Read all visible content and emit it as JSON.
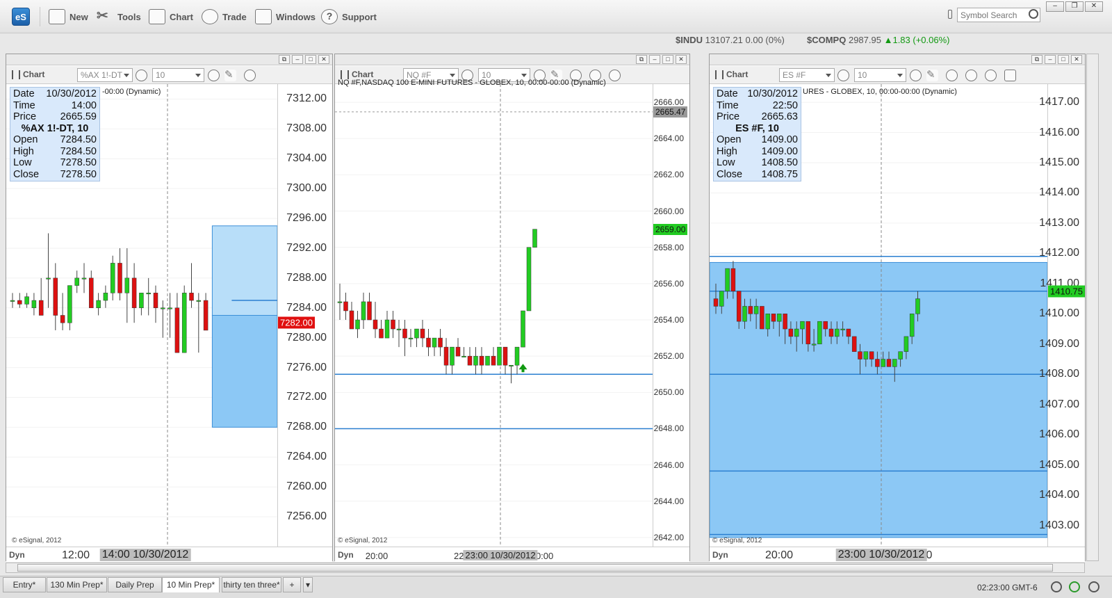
{
  "app": {
    "logo": "eS"
  },
  "toolbar": {
    "items": [
      {
        "label": "New",
        "icon": "new-window-icon"
      },
      {
        "label": "Tools",
        "icon": "tools-icon"
      },
      {
        "label": "Chart",
        "icon": "chart-icon"
      },
      {
        "label": "Trade",
        "icon": "trade-globe-icon"
      },
      {
        "label": "Windows",
        "icon": "windows-icon"
      },
      {
        "label": "Support",
        "icon": "help-icon"
      }
    ],
    "search_placeholder": "Symbol Search"
  },
  "tickers": [
    {
      "sym": "$INDU",
      "price": "13107.21",
      "chg": "0.00 (0%)",
      "dir": "flat"
    },
    {
      "sym": "$COMPQ",
      "price": "2987.95",
      "chg": "1.83 (+0.06%)",
      "dir": "up"
    }
  ],
  "panels": [
    {
      "chart_label": "Chart",
      "symbol": "%AX 1!-DT",
      "interval": "10",
      "header": "-00:00 (Dynamic)",
      "info": {
        "date": "10/30/2012",
        "time": "14:00",
        "price": "2665.59",
        "title": "%AX 1!-DT, 10",
        "open": "7284.50",
        "high": "7284.50",
        "low": "7278.50",
        "close": "7278.50"
      },
      "price_tag": "7282.00",
      "price_tag_color": "#e01010",
      "copyright": "© eSignal, 2012",
      "dyn": "Dyn",
      "x_labels": [
        "12:00"
      ],
      "x_cursor": "14:00 10/30/2012"
    },
    {
      "chart_label": "Chart",
      "symbol": "NQ #F",
      "interval": "10",
      "header": "NQ #F,NASDAQ 100 E-MINI FUTURES - GLOBEX, 10, 00:00-00:00 (Dynamic)",
      "price_tag": "2659.00",
      "price_tag_color": "#22cc22",
      "cursor_tag": "2665.47",
      "copyright": "© eSignal, 2012",
      "dyn": "Dyn",
      "x_labels": [
        "20:00",
        "22:",
        "00:00"
      ],
      "x_cursor": "23:00 10/30/2012"
    },
    {
      "chart_label": "Chart",
      "symbol": "ES #F",
      "interval": "10",
      "header": "URES - GLOBEX, 10, 00:00-00:00 (Dynamic)",
      "info": {
        "date": "10/30/2012",
        "time": "22:50",
        "price": "2665.63",
        "title": "ES #F, 10",
        "open": "1409.00",
        "high": "1409.00",
        "low": "1408.50",
        "close": "1408.75"
      },
      "price_tag": "1410.75",
      "price_tag_color": "#22cc22",
      "copyright": "© eSignal, 2012",
      "dyn": "Dyn",
      "x_labels": [
        "20:00",
        "0"
      ],
      "x_cursor": "23:00 10/30/2012"
    }
  ],
  "info_labels": {
    "date": "Date",
    "time": "Time",
    "price": "Price",
    "open": "Open",
    "high": "High",
    "low": "Low",
    "close": "Close"
  },
  "tabs": [
    "Entry*",
    "130 Min Prep*",
    "Daily Prep",
    "10 Min Prep*",
    "thirty ten three*",
    "+"
  ],
  "active_tab": "10 Min Prep*",
  "status": {
    "time": "02:23:00",
    "tz": "GMT-6"
  },
  "chart_data": [
    {
      "type": "candlestick",
      "symbol": "%AX 1!-DT",
      "interval": "10",
      "ylim": [
        7252,
        7314
      ],
      "y_ticks": [
        "7312.00",
        "7308.00",
        "7304.00",
        "7300.00",
        "7296.00",
        "7292.00",
        "7288.00",
        "7284.00",
        "7280.00",
        "7276.00",
        "7272.00",
        "7268.00",
        "7264.00",
        "7260.00",
        "7256.00"
      ],
      "candles": [
        [
          7285,
          7286,
          7284,
          7285
        ],
        [
          7285,
          7286,
          7284,
          7284.5
        ],
        [
          7284.5,
          7286,
          7284,
          7285.5
        ],
        [
          7284,
          7286,
          7283,
          7285
        ],
        [
          7285,
          7288,
          7284,
          7283
        ],
        [
          7288,
          7294,
          7284,
          7288
        ],
        [
          7288,
          7290,
          7281,
          7283
        ],
        [
          7283,
          7286,
          7281,
          7282
        ],
        [
          7282,
          7287,
          7281,
          7287
        ],
        [
          7287,
          7289,
          7286,
          7288
        ],
        [
          7288,
          7290,
          7286,
          7288
        ],
        [
          7288,
          7289,
          7285,
          7284
        ],
        [
          7284,
          7286,
          7283,
          7285
        ],
        [
          7285,
          7287,
          7284,
          7286
        ],
        [
          7286,
          7291,
          7285,
          7290
        ],
        [
          7290,
          7292,
          7285,
          7286
        ],
        [
          7286,
          7292,
          7282,
          7288
        ],
        [
          7288,
          7290,
          7282,
          7284
        ],
        [
          7284,
          7286,
          7283,
          7286
        ],
        [
          7286,
          7288,
          7283,
          7286
        ],
        [
          7286,
          7287,
          7282,
          7284
        ],
        [
          7284,
          7285,
          7280,
          7284
        ],
        [
          7284,
          7286,
          7280,
          7284
        ],
        [
          7284,
          7286,
          7278,
          7278
        ],
        [
          7278,
          7287,
          7278,
          7286
        ],
        [
          7286,
          7290,
          7284,
          7285
        ],
        [
          7285,
          7286,
          7278,
          7285
        ],
        [
          7285,
          7286,
          7281,
          7281
        ]
      ],
      "zones": [
        {
          "from": 7268,
          "to": 7283
        },
        {
          "from": 7283,
          "to": 7295
        }
      ],
      "hlines": [
        7285
      ]
    },
    {
      "type": "candlestick",
      "symbol": "NQ #F",
      "interval": "10",
      "ylim": [
        2641.5,
        2667
      ],
      "y_ticks": [
        "2666.00",
        "2664.00",
        "2662.00",
        "2660.00",
        "2658.00",
        "2656.00",
        "2654.00",
        "2652.00",
        "2650.00",
        "2648.00",
        "2646.00",
        "2644.00",
        "2642.00"
      ],
      "candles": [
        [
          2655,
          2656,
          2654,
          2655
        ],
        [
          2655,
          2655.5,
          2654,
          2654.5
        ],
        [
          2654.5,
          2655,
          2653.5,
          2653.5
        ],
        [
          2653.5,
          2654.5,
          2653,
          2654
        ],
        [
          2654,
          2655.5,
          2653.5,
          2655
        ],
        [
          2655,
          2655.5,
          2654,
          2654
        ],
        [
          2654,
          2655,
          2653,
          2653.5
        ],
        [
          2653.5,
          2654,
          2653,
          2653
        ],
        [
          2653,
          2654.5,
          2653,
          2654
        ],
        [
          2654,
          2654.5,
          2653,
          2653.5
        ],
        [
          2653.5,
          2654,
          2652.5,
          2653.5
        ],
        [
          2653.5,
          2654,
          2652,
          2653
        ],
        [
          2653,
          2653.5,
          2652.5,
          2653
        ],
        [
          2653,
          2653.5,
          2652.5,
          2653.5
        ],
        [
          2653.5,
          2654,
          2652.5,
          2653
        ],
        [
          2653,
          2653.5,
          2652,
          2652.5
        ],
        [
          2652.5,
          2653,
          2652,
          2653
        ],
        [
          2653,
          2653.5,
          2652,
          2652.5
        ],
        [
          2652.5,
          2653,
          2651,
          2651.5
        ],
        [
          2651.5,
          2652.5,
          2651,
          2652.5
        ],
        [
          2652.5,
          2653,
          2652,
          2652
        ],
        [
          2652,
          2652.5,
          2652,
          2652
        ],
        [
          2652,
          2652.5,
          2651.5,
          2651.5
        ],
        [
          2651.5,
          2652.5,
          2651,
          2652
        ],
        [
          2652,
          2652.5,
          2651,
          2651.5
        ],
        [
          2651.5,
          2652,
          2651.5,
          2652
        ],
        [
          2652,
          2652.5,
          2651.5,
          2651.5
        ],
        [
          2651.5,
          2652.5,
          2651.5,
          2652.5
        ],
        [
          2652.5,
          2652.5,
          2651,
          2651.5
        ],
        [
          2651.5,
          2651.5,
          2650.5,
          2651.5
        ],
        [
          2651.5,
          2652.5,
          2651,
          2652.5
        ],
        [
          2652.5,
          2654.5,
          2652.5,
          2654.5
        ],
        [
          2654.5,
          2658,
          2654.5,
          2658
        ],
        [
          2658,
          2659,
          2658,
          2659
        ]
      ],
      "zones": [],
      "hlines": [
        2651,
        2648
      ],
      "cursor_hline": 2665.47,
      "arrow_at": 2651.5
    },
    {
      "type": "candlestick",
      "symbol": "ES #F",
      "interval": "10",
      "ylim": [
        1402.3,
        1417.6
      ],
      "y_ticks": [
        "1417.00",
        "1416.00",
        "1415.00",
        "1414.00",
        "1413.00",
        "1412.00",
        "1411.00",
        "1410.00",
        "1409.00",
        "1408.00",
        "1407.00",
        "1406.00",
        "1405.00",
        "1404.00",
        "1403.00"
      ],
      "candles": [
        [
          1410.5,
          1411,
          1410,
          1410.25
        ],
        [
          1410.25,
          1410.5,
          1410,
          1410.75
        ],
        [
          1410.75,
          1411.5,
          1410.5,
          1411.5
        ],
        [
          1411.5,
          1411.75,
          1410.5,
          1410.75
        ],
        [
          1410.75,
          1410.75,
          1409.5,
          1409.75
        ],
        [
          1409.75,
          1410.5,
          1409.5,
          1410.25
        ],
        [
          1410.25,
          1410.5,
          1409.75,
          1410
        ],
        [
          1410,
          1410.5,
          1409.5,
          1410.25
        ],
        [
          1410.25,
          1410.25,
          1409.5,
          1409.5
        ],
        [
          1409.5,
          1410,
          1409.25,
          1410
        ],
        [
          1410,
          1410,
          1409.5,
          1409.75
        ],
        [
          1409.75,
          1410,
          1409.25,
          1410
        ],
        [
          1410,
          1410,
          1409,
          1409.5
        ],
        [
          1409.5,
          1409.75,
          1409,
          1409.25
        ],
        [
          1409.25,
          1409.75,
          1408.75,
          1409.5
        ],
        [
          1409.5,
          1409.75,
          1409,
          1409.75
        ],
        [
          1409.75,
          1409.75,
          1408.75,
          1409
        ],
        [
          1409,
          1409.5,
          1408.75,
          1409
        ],
        [
          1409,
          1409.75,
          1409,
          1409.75
        ],
        [
          1409.75,
          1409.75,
          1409.25,
          1409.5
        ],
        [
          1409.5,
          1409.75,
          1409,
          1409.25
        ],
        [
          1409.25,
          1409.75,
          1409,
          1409.5
        ],
        [
          1409.5,
          1409.75,
          1409.25,
          1409.5
        ],
        [
          1409.5,
          1409.5,
          1409,
          1409.25
        ],
        [
          1409.25,
          1409.25,
          1408.75,
          1408.75
        ],
        [
          1408.75,
          1409,
          1408,
          1408.5
        ],
        [
          1408.5,
          1408.75,
          1408.25,
          1408.75
        ],
        [
          1408.75,
          1408.75,
          1408.25,
          1408.5
        ],
        [
          1408.5,
          1408.75,
          1408,
          1408.25
        ],
        [
          1408.25,
          1408.75,
          1408.25,
          1408.5
        ],
        [
          1408.5,
          1408.75,
          1408.25,
          1408.25
        ],
        [
          1408.25,
          1408.5,
          1407.75,
          1408.5
        ],
        [
          1408.5,
          1408.75,
          1408.25,
          1408.75
        ],
        [
          1408.75,
          1409.25,
          1408.5,
          1409.25
        ],
        [
          1409.25,
          1410,
          1409,
          1410
        ],
        [
          1410,
          1410.75,
          1409.75,
          1410.5
        ]
      ],
      "zones": [
        {
          "from": 1402.6,
          "to": 1411.7
        }
      ],
      "hlines": [
        1411.9,
        1410.75,
        1408,
        1404.8,
        1402.7
      ]
    }
  ]
}
